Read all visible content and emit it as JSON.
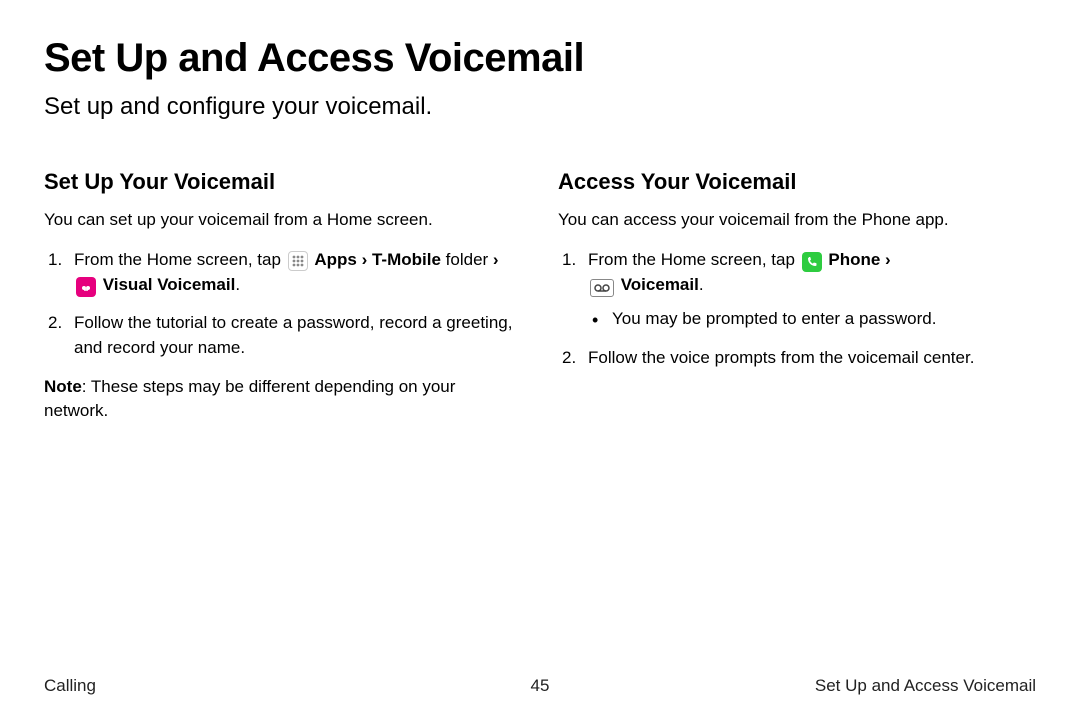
{
  "header": {
    "title": "Set Up and Access Voicemail",
    "subtitle": "Set up and configure your voicemail."
  },
  "left": {
    "heading": "Set Up Your Voicemail",
    "intro": "You can set up your voicemail from a Home screen.",
    "step1_a": "From the Home screen, tap ",
    "step1_apps": "Apps",
    "step1_chev1": " › ",
    "step1_tmobile": "T-Mobile",
    "step1_folder": " folder",
    "step1_chev2": " › ",
    "step1_vv": " Visual Voicemail",
    "step1_end": ".",
    "step2": "Follow the tutorial to create a password, record a greeting, and record your name.",
    "note_label": "Note",
    "note_body": ": These steps may be different depending on your network."
  },
  "right": {
    "heading": "Access Your Voicemail",
    "intro": "You can access your voicemail from the Phone app.",
    "step1_a": "From the Home screen, tap ",
    "step1_phone": "Phone",
    "step1_chev": " › ",
    "step1_vm": " Voicemail",
    "step1_end": ".",
    "step1_sub": "You may be prompted to enter a password.",
    "step2": "Follow the voice prompts from the voicemail center."
  },
  "footer": {
    "left": "Calling",
    "center": "45",
    "right": "Set Up and Access Voicemail"
  },
  "icons": {
    "apps": "apps-icon",
    "visual_voicemail": "visual-voicemail-icon",
    "phone": "phone-icon",
    "voicemail": "voicemail-icon"
  }
}
